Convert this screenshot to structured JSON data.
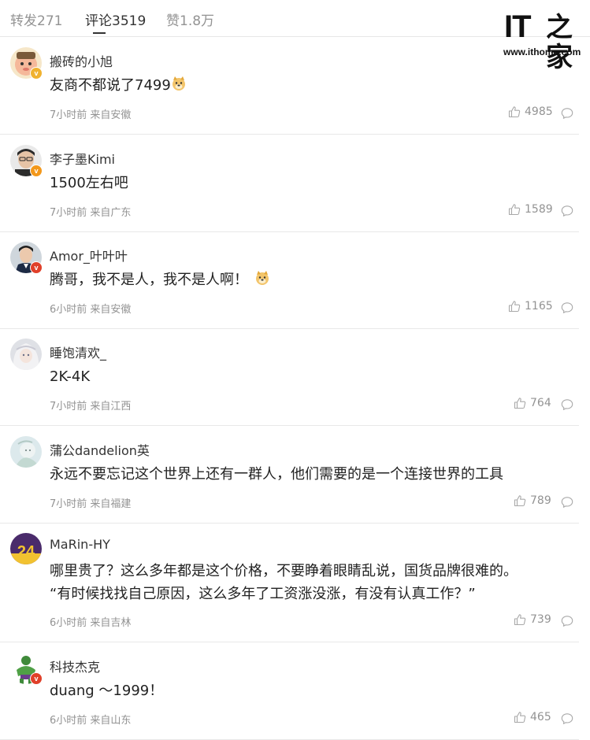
{
  "tabs": [
    {
      "label": "转发271"
    },
    {
      "label": "评论3519"
    },
    {
      "label": "赞1.8万"
    }
  ],
  "logo": {
    "mark": "IT",
    "zh": "之家",
    "url": "www.ithome.com"
  },
  "comments": [
    {
      "name": "搬砖的小旭",
      "text": "友商不都说了7499",
      "meta": "7小时前 来自安徽",
      "likes": "4985",
      "badge": "gold"
    },
    {
      "name": "李子墨Kimi",
      "text": "1500左右吧",
      "meta": "7小时前 来自广东",
      "likes": "1589",
      "badge": "orange"
    },
    {
      "name": "Amor_叶叶叶",
      "text": "腾哥，我不是人，我不是人啊！",
      "meta": "6小时前 来自安徽",
      "likes": "1165",
      "badge": "red"
    },
    {
      "name": "睡饱清欢_",
      "text": "2K-4K",
      "meta": "7小时前 来自江西",
      "likes": "764",
      "badge": ""
    },
    {
      "name": "蒲公dandelion英",
      "text": "永远不要忘记这个世界上还有一群人，他们需要的是一个连接世界的工具",
      "meta": "7小时前 来自福建",
      "likes": "789",
      "badge": ""
    },
    {
      "name": "MaRin-HY",
      "text": "哪里贵了？这么多年都是这个价格，不要睁着眼睛乱说，国货品牌很难的。",
      "text2": "“有时候找找自己原因，这么多年了工资涨没涨，有没有认真工作？”",
      "meta": "6小时前 来自吉林",
      "likes": "739",
      "badge": ""
    },
    {
      "name": "科技杰克",
      "text": "duang ～1999！",
      "meta": "6小时前 来自山东",
      "likes": "465",
      "badge": "red"
    }
  ]
}
